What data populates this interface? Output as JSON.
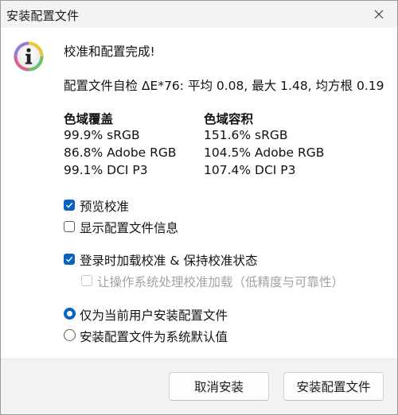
{
  "window": {
    "title": "安装配置文件"
  },
  "message": {
    "heading": "校准和配置完成!",
    "profile_check": "配置文件自检 ΔE*76: 平均 0.08, 最大 1.48, 均方根 0.19"
  },
  "gamut": {
    "coverage_header": "色域覆盖",
    "coverage": [
      "99.9% sRGB",
      "86.8% Adobe RGB",
      "99.1% DCI P3"
    ],
    "volume_header": "色域容积",
    "volume": [
      "151.6% sRGB",
      "104.5% Adobe RGB",
      "107.4% DCI P3"
    ]
  },
  "options": {
    "preview_calibration": {
      "label": "预览校准",
      "checked": true
    },
    "show_profile_info": {
      "label": "显示配置文件信息",
      "checked": false
    },
    "load_on_login": {
      "label": "登录时加载校准 & 保持校准状态",
      "checked": true
    },
    "os_handle_loading": {
      "label": "让操作系统处理校准加载（低精度与可靠性）",
      "checked": false,
      "disabled": true
    }
  },
  "install_scope": {
    "current_user": {
      "label": "仅为当前用户安装配置文件",
      "selected": true
    },
    "system_default": {
      "label": "安装配置文件为系统默认值",
      "selected": false
    }
  },
  "buttons": {
    "cancel": "取消安装",
    "install": "安装配置文件"
  },
  "colors": {
    "accent": "#0a62c1",
    "titlebar": "#f3f3f3",
    "footer": "#f3f3f3"
  },
  "icons": {
    "close": "close-icon",
    "info": "info-icon",
    "checkmark": "checkmark-icon"
  }
}
